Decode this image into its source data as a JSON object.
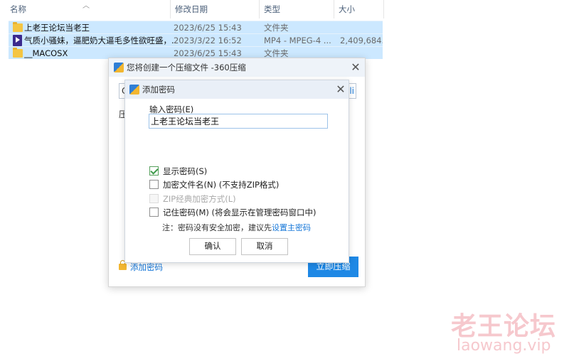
{
  "explorer": {
    "columns": {
      "name": "名称",
      "modified": "修改日期",
      "type": "类型",
      "size": "大小"
    },
    "rows": [
      {
        "name": "上老王论坛当老王",
        "modified": "2023/6/25 15:43",
        "type": "文件夹",
        "size": "",
        "icon": "folder-icon"
      },
      {
        "name": "气质小骚妹，逼肥奶大逼毛多性欲旺盛，...",
        "modified": "2023/3/22 16:52",
        "type": "MP4 - MPEG-4 ...",
        "size": "2,409,684...",
        "icon": "video-file-icon"
      },
      {
        "name": "__MACOSX",
        "modified": "2023/6/25 15:43",
        "type": "文件夹",
        "size": "",
        "icon": "folder-icon"
      }
    ]
  },
  "outer_dialog": {
    "title": "您将创建一个压缩文件 -360压缩",
    "path_prefix": "C",
    "browse_suffix": "li",
    "label_partial": "压",
    "add_password_link": "添加密码",
    "compress_now": "立即压缩"
  },
  "password_dialog": {
    "title": "添加密码",
    "input_label": "输入密码(E)",
    "password_value": "上老王论坛当老王",
    "options": [
      {
        "label": "显示密码(S)",
        "checked": true,
        "disabled": false
      },
      {
        "label": "加密文件名(N) (不支持ZIP格式)",
        "checked": false,
        "disabled": false
      },
      {
        "label": "ZIP经典加密方式(L)",
        "checked": false,
        "disabled": true
      },
      {
        "label": "记住密码(M) (将会显示在管理密码窗口中)",
        "checked": false,
        "disabled": false
      }
    ],
    "note_prefix": "注：密码没有安全加密，建议先",
    "note_link": "设置主密码",
    "ok": "确认",
    "cancel": "取消"
  },
  "watermark": {
    "cn": "老王论坛",
    "en": "laowang.vip"
  },
  "colors": {
    "selection": "#cce8ff",
    "accent": "#1e88e5",
    "link": "#1677d8",
    "watermark": "#f6c8cd"
  }
}
